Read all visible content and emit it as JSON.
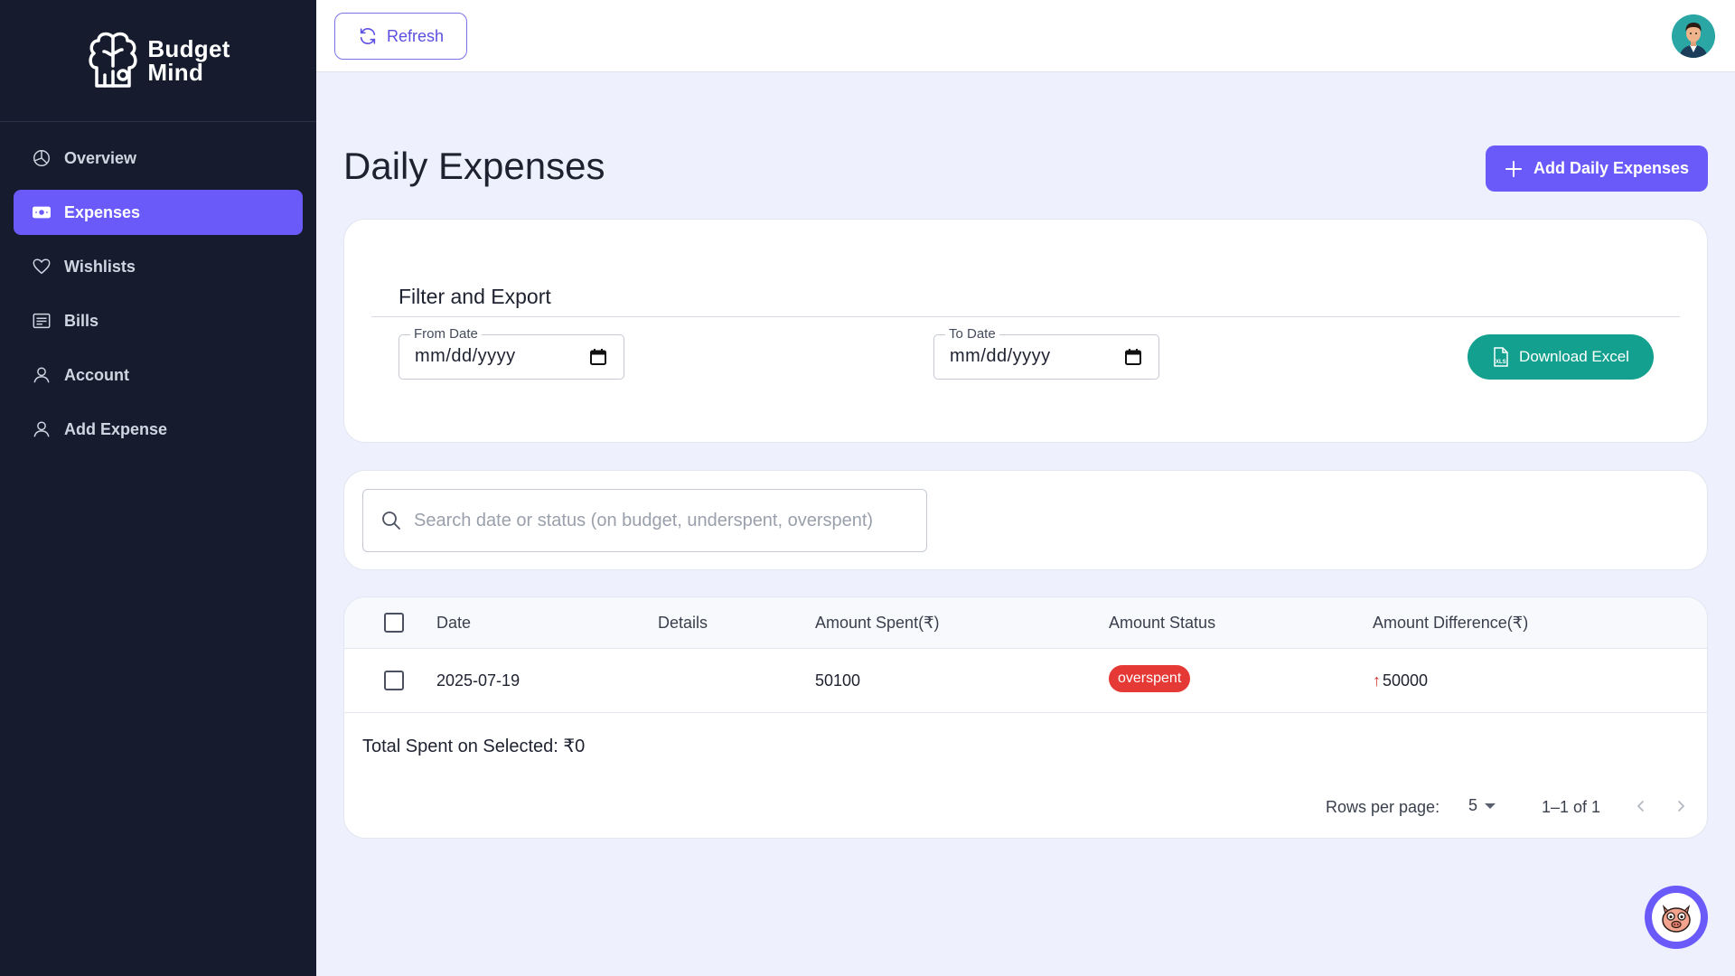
{
  "brand": {
    "line1": "Budget",
    "line2": "Mind"
  },
  "sidebar": {
    "items": [
      {
        "label": "Overview",
        "icon": "pie-chart-icon",
        "active": false
      },
      {
        "label": "Expenses",
        "icon": "money-icon",
        "active": true
      },
      {
        "label": "Wishlists",
        "icon": "heart-icon",
        "active": false
      },
      {
        "label": "Bills",
        "icon": "receipt-icon",
        "active": false
      },
      {
        "label": "Account",
        "icon": "user-icon",
        "active": false
      },
      {
        "label": "Add Expense",
        "icon": "user-icon",
        "active": false
      }
    ]
  },
  "topbar": {
    "refresh_label": "Refresh",
    "avatar_icon": "user-avatar"
  },
  "page": {
    "title": "Daily Expenses",
    "add_button_label": "Add Daily Expenses"
  },
  "filter": {
    "title": "Filter and Export",
    "from_label": "From Date",
    "from_value": "mm/dd/yyyy",
    "to_label": "To Date",
    "to_value": "mm/dd/yyyy",
    "download_label": "Download Excel"
  },
  "search": {
    "placeholder": "Search date or status (on budget, underspent, overspent)",
    "value": ""
  },
  "table": {
    "columns": [
      "Date",
      "Details",
      "Amount Spent(₹)",
      "Amount Status",
      "Amount Difference(₹)"
    ],
    "rows": [
      {
        "date": "2025-07-19",
        "details": "",
        "amount_spent": "50100",
        "status": "overspent",
        "difference": "50000",
        "difference_direction": "up"
      }
    ],
    "total_label": "Total Spent on Selected: ₹0",
    "rows_per_page_label": "Rows per page:",
    "rows_per_page_value": "5",
    "range_label": "1–1 of 1"
  },
  "colors": {
    "accent": "#6a5af9",
    "sidebar_bg": "#161c2d",
    "success": "#14a08f",
    "danger": "#e53935",
    "page_bg": "#eef1fd"
  }
}
